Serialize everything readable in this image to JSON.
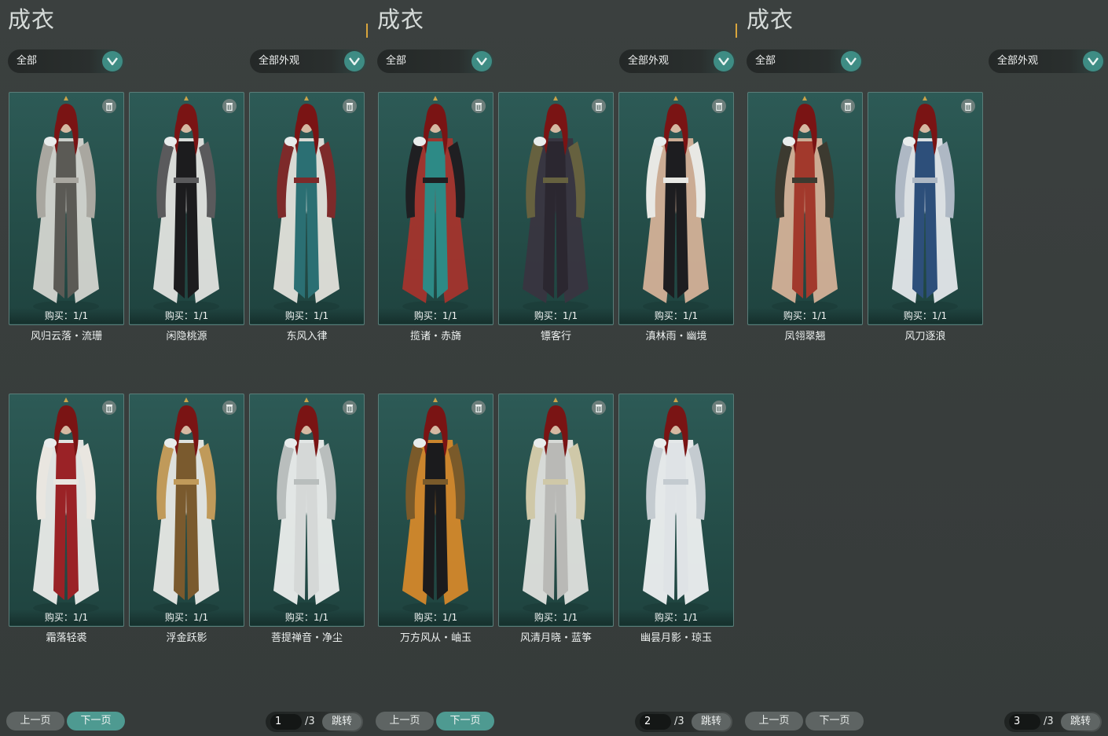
{
  "colors": {
    "accent": "#4e9a91",
    "card_bg": "#2a5450",
    "panel_bg": "#3a3f3e",
    "mark": "#d9a53c"
  },
  "panels": [
    {
      "title": "成衣",
      "filter_all": "全部",
      "filter_look": "全部外观",
      "items": [
        {
          "name": "风归云落・流珊",
          "buy": "购买：1/1",
          "outfit": "gray-white"
        },
        {
          "name": "闲隐桃源",
          "buy": "购买：1/1",
          "outfit": "black-white"
        },
        {
          "name": "东风入律",
          "buy": "购买：1/1",
          "outfit": "white-teal"
        },
        {
          "name": "霜落轻裘",
          "buy": "购买：1/1",
          "outfit": "red-white"
        },
        {
          "name": "浮金跃影",
          "buy": "购买：1/1",
          "outfit": "gold-white"
        },
        {
          "name": "菩提禅音・净尘",
          "buy": "购买：1/1",
          "outfit": "white"
        }
      ],
      "prev_label": "上一页",
      "next_label": "下一页",
      "page_current": "1",
      "page_total": "/3",
      "jump_label": "跳转"
    },
    {
      "title": "成衣",
      "filter_all": "全部",
      "filter_look": "全部外观",
      "items": [
        {
          "name": "揽诸・赤旖",
          "buy": "购买：1/1",
          "outfit": "red-teal"
        },
        {
          "name": "镖客行",
          "buy": "购买：1/1",
          "outfit": "dark-purple"
        },
        {
          "name": "滇林雨・幽境",
          "buy": "购买：1/1",
          "outfit": "bare-black"
        },
        {
          "name": "万方风从・岫玉",
          "buy": "购买：1/1",
          "outfit": "tiger-black"
        },
        {
          "name": "风清月晓・蓝筝",
          "buy": "购买：1/1",
          "outfit": "white-gray"
        },
        {
          "name": "幽昙月影・琼玉",
          "buy": "购买：1/1",
          "outfit": "pure-white"
        }
      ],
      "prev_label": "上一页",
      "next_label": "下一页",
      "page_current": "2",
      "page_total": "/3",
      "jump_label": "跳转"
    },
    {
      "title": "成衣",
      "filter_all": "全部",
      "filter_look": "全部外观",
      "items": [
        {
          "name": "凤翎翠翘",
          "buy": "购买：1/1",
          "outfit": "bare-red"
        },
        {
          "name": "风刀逐浪",
          "buy": "购买：1/1",
          "outfit": "blue-white"
        }
      ],
      "prev_label": "上一页",
      "next_label": "下一页",
      "page_current": "3",
      "page_total": "/3",
      "jump_label": "跳转"
    }
  ]
}
